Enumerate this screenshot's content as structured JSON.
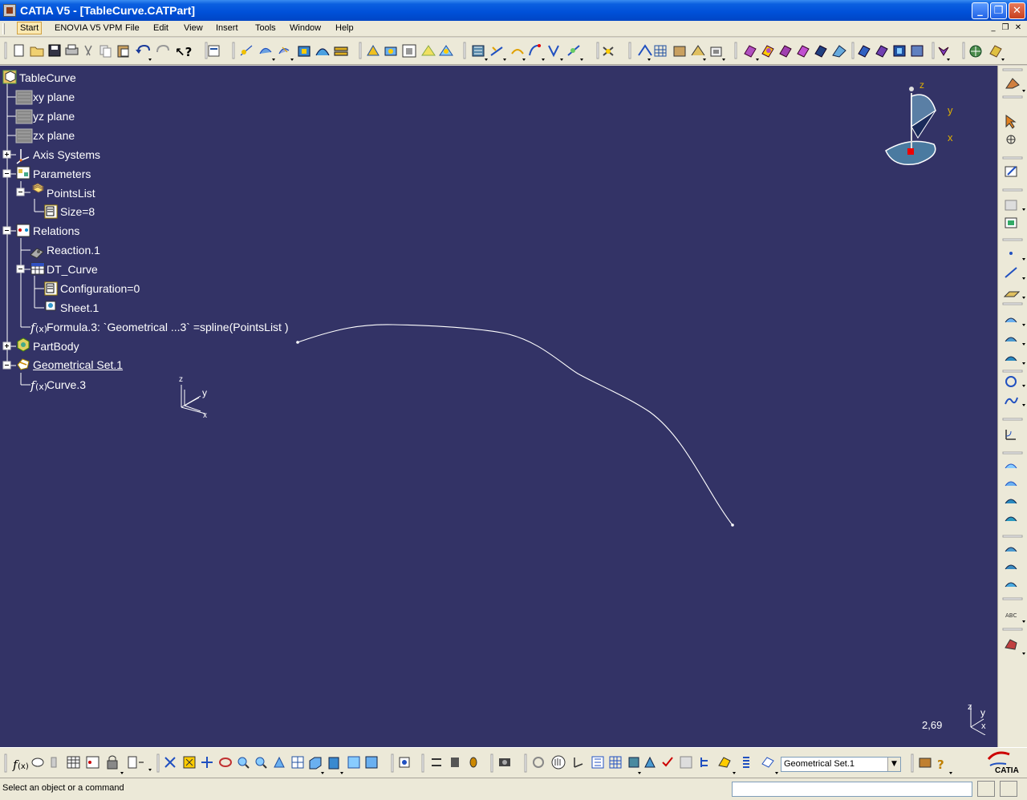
{
  "window": {
    "title": "CATIA V5 - [TableCurve.CATPart]",
    "minimize": "_",
    "maximize": "❐",
    "close": "✕"
  },
  "menu": {
    "items": [
      "Start",
      "ENOVIA V5 VPM",
      "File",
      "Edit",
      "View",
      "Insert",
      "Tools",
      "Window",
      "Help"
    ],
    "mdi": [
      "_",
      "❐",
      "✕"
    ]
  },
  "tree": {
    "root": "TableCurve",
    "nodes": [
      {
        "label": "xy plane"
      },
      {
        "label": "yz plane"
      },
      {
        "label": "zx plane"
      },
      {
        "label": "Axis Systems"
      },
      {
        "label": "Parameters"
      },
      {
        "label": "PointsList"
      },
      {
        "label": "Size=8"
      },
      {
        "label": "Relations"
      },
      {
        "label": "Reaction.1"
      },
      {
        "label": "DT_Curve"
      },
      {
        "label": "Configuration=0"
      },
      {
        "label": "Sheet.1"
      },
      {
        "label": "Formula.3:  `Geometrical ...3` =spline(PointsList )"
      },
      {
        "label": "PartBody"
      },
      {
        "label": "Geometrical Set.1"
      },
      {
        "label": "Curve.3"
      }
    ]
  },
  "compass": {
    "z": "z",
    "y": "y",
    "x": "x"
  },
  "axis_small": {
    "z": "z",
    "y": "y",
    "x": "x"
  },
  "axis_corner": {
    "z": "z",
    "y": "y",
    "x": "x"
  },
  "viewport": {
    "scale": "2,69",
    "background": "#333366",
    "curve_color": "#ffffff"
  },
  "bottom": {
    "current_set": "Geometrical Set.1",
    "brand": "CATIA"
  },
  "status": {
    "message": "Select an object or a command"
  }
}
